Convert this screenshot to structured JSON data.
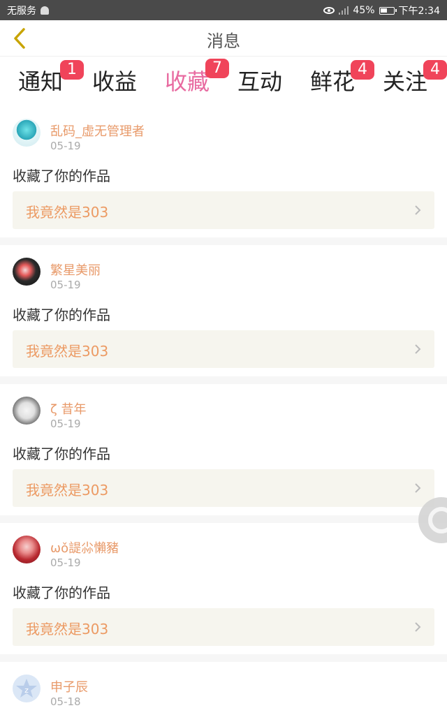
{
  "status_bar": {
    "carrier": "无服务",
    "battery": "45%",
    "time": "下午2:34"
  },
  "header": {
    "title": "消息"
  },
  "tabs": [
    {
      "label": "通知",
      "badge": "1"
    },
    {
      "label": "收益",
      "badge": ""
    },
    {
      "label": "收藏",
      "badge": "7"
    },
    {
      "label": "互动",
      "badge": ""
    },
    {
      "label": "鲜花",
      "badge": "4"
    },
    {
      "label": "关注",
      "badge": "4"
    }
  ],
  "active_tab": "收藏",
  "colors": {
    "accent": "#e86aa0",
    "badge": "#f0445a",
    "username": "#e89a6a",
    "work_title": "#ec9a63",
    "work_box": "#f6f5ee"
  },
  "messages": [
    {
      "user": "乱码_虚无管理者",
      "date": "05-19",
      "action": "收藏了你的作品",
      "work": "我竟然是303"
    },
    {
      "user": "繁星美丽",
      "date": "05-19",
      "action": "收藏了你的作品",
      "work": "我竟然是303"
    },
    {
      "user": "ζ 昔年",
      "date": "05-19",
      "action": "收藏了你的作品",
      "work": "我竟然是303"
    },
    {
      "user": "ωǒ諟尛懶豬",
      "date": "05-19",
      "action": "收藏了你的作品",
      "work": "我竟然是303"
    },
    {
      "user": "申子辰",
      "date": "05-18",
      "action": "",
      "work": ""
    }
  ]
}
